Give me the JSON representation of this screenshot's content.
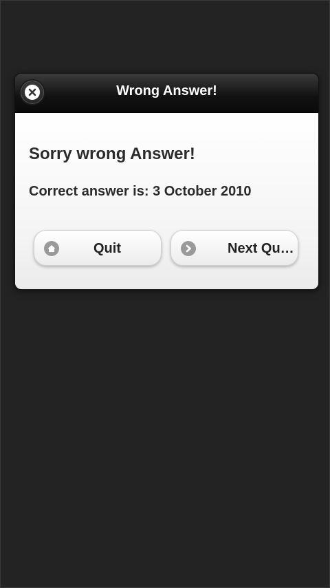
{
  "dialog": {
    "title": "Wrong Answer!",
    "heading": "Sorry wrong Answer!",
    "message": "Correct answer is: 3 October 2010",
    "buttons": {
      "quit_label": "Quit",
      "next_label": "Next Qu…"
    }
  },
  "icons": {
    "close": "close-icon",
    "quit": "home-icon",
    "next": "chevron-right-icon"
  },
  "colors": {
    "background": "#232323",
    "header": "#111111",
    "body": "#f4f4f4",
    "text": "#2b2b2b",
    "icon_grey": "#9a9a9a"
  }
}
